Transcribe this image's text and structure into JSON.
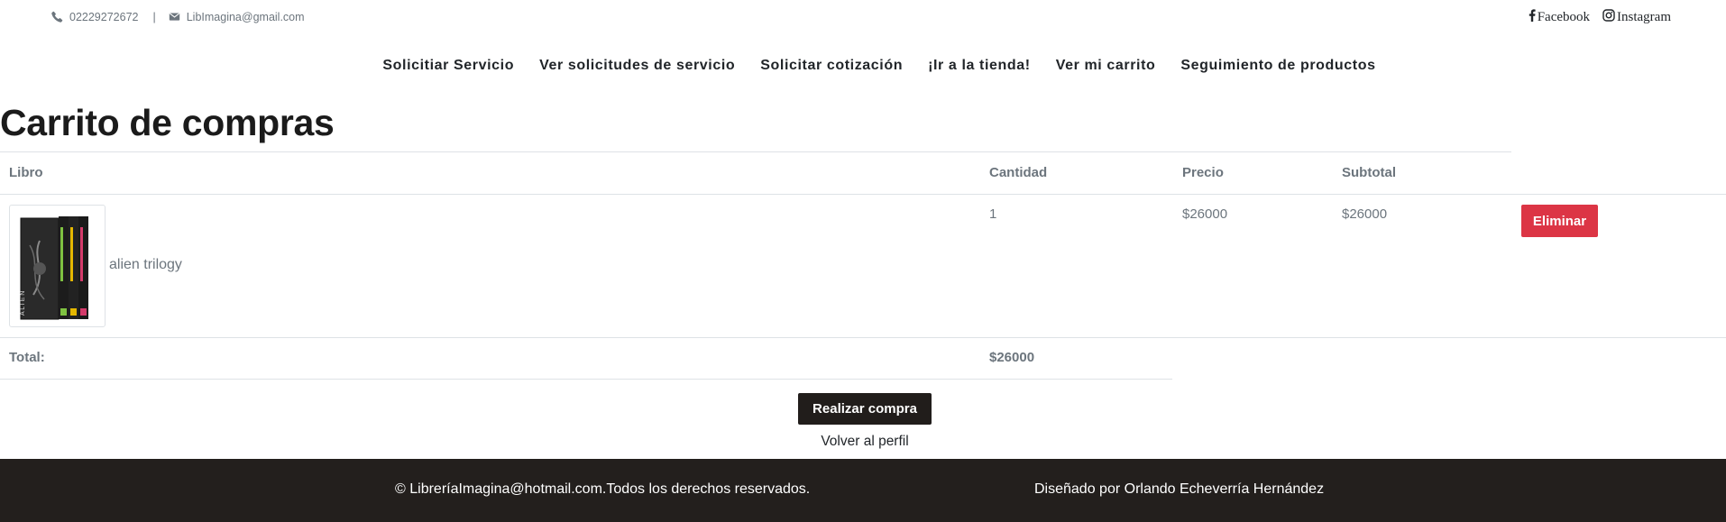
{
  "topbar": {
    "phone": "02229272672",
    "separator": "|",
    "email": "LibImagina@gmail.com",
    "social": [
      {
        "label": "Facebook",
        "icon": "facebook-icon"
      },
      {
        "label": "Instagram",
        "icon": "instagram-icon"
      }
    ]
  },
  "nav": {
    "items": [
      "Solicitiar Servicio",
      "Ver solicitudes de servicio",
      "Solicitar cotización",
      "¡Ir a la tienda!",
      "Ver mi carrito",
      "Seguimiento de productos"
    ]
  },
  "page": {
    "title": "Carrito de compras"
  },
  "cart": {
    "headers": [
      "Libro",
      "Cantidad",
      "Precio",
      "Subtotal"
    ],
    "items": [
      {
        "name": "alien trilogy",
        "quantity": "1",
        "price": "$26000",
        "subtotal": "$26000",
        "delete_label": "Eliminar"
      }
    ],
    "total_label": "Total:",
    "total_value": "$26000",
    "buy_label": "Realizar compra",
    "back_label": "Volver al perfil"
  },
  "footer": {
    "copyright": "© LibreríaImagina@hotmail.com.Todos los derechos reservados.",
    "designer": "Diseñado por Orlando Echeverría Hernández"
  },
  "colors": {
    "danger": "#dc3545",
    "dark": "#231f1d",
    "muted": "#6c757d",
    "text": "#212529"
  }
}
